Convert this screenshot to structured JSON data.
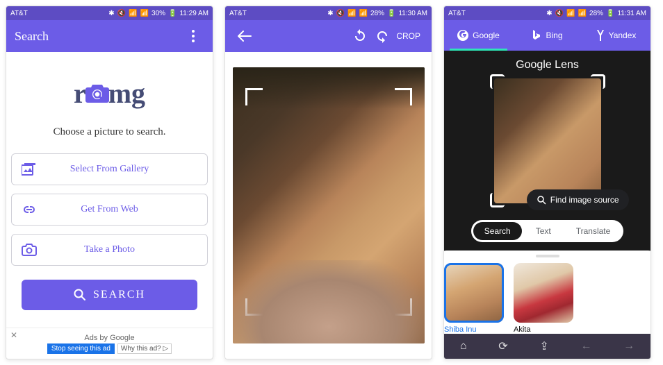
{
  "p1": {
    "status": {
      "carrier": "AT&T",
      "battery": "30%",
      "time": "11:29 AM"
    },
    "appbar_title": "Search",
    "logo_r": "r",
    "logo_mg": "mg",
    "prompt": "Choose a picture to search.",
    "btn_gallery": "Select From Gallery",
    "btn_web": "Get From Web",
    "btn_photo": "Take a Photo",
    "btn_search": "SEARCH",
    "ads_label": "Ads by Google",
    "ads_stop": "Stop seeing this ad",
    "ads_why": "Why this ad? ▷"
  },
  "p2": {
    "status": {
      "carrier": "AT&T",
      "battery": "28%",
      "time": "11:30 AM"
    },
    "crop_label": "CROP"
  },
  "p3": {
    "status": {
      "carrier": "AT&T",
      "battery": "28%",
      "time": "11:31 AM"
    },
    "tabs": {
      "google": "Google",
      "bing": "Bing",
      "yandex": "Yandex"
    },
    "lens_title": "Google Lens",
    "fis": "Find image source",
    "seg": {
      "search": "Search",
      "text": "Text",
      "translate": "Translate"
    },
    "results": {
      "r1": "Shiba Inu",
      "r2": "Akita"
    }
  }
}
